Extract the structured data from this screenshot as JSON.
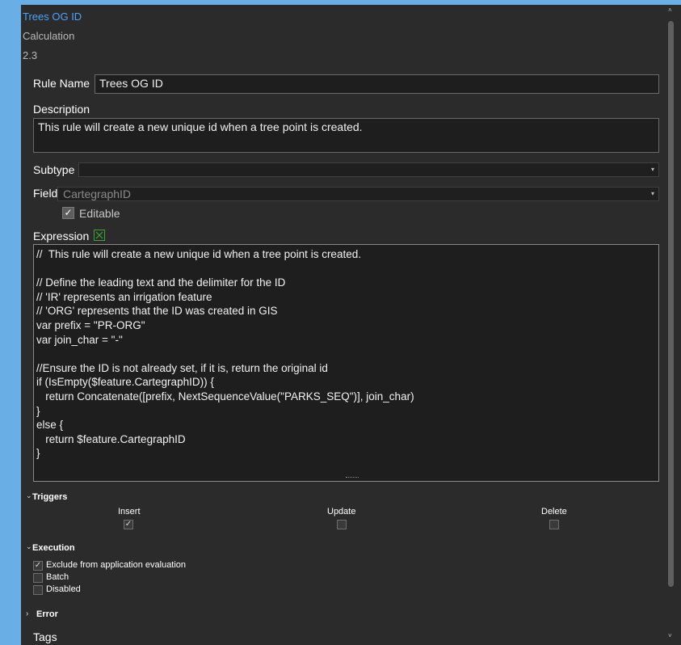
{
  "header": {
    "title": "Trees OG ID",
    "subtitle": "Calculation",
    "version": "2.3"
  },
  "form": {
    "rule_name_label": "Rule Name",
    "rule_name_value": "Trees OG ID",
    "description_label": "Description",
    "description_value": "This rule will create a new unique id when a tree point is created.",
    "subtype_label": "Subtype",
    "subtype_value": "",
    "field_label": "Field",
    "field_value": "CartegraphID",
    "editable_label": "Editable",
    "editable_checked": true,
    "expression_label": "Expression"
  },
  "expression_lines": [
    "//  This rule will create a new unique id when a tree point is created.",
    "",
    "// Define the leading text and the delimiter for the ID",
    "// 'IR' represents an irrigation feature",
    "// 'ORG' represents that the ID was created in GIS",
    "var prefix = \"PR-ORG\"",
    "var join_char = \"-\"",
    "",
    "//Ensure the ID is not already set, if it is, return the original id",
    "if (IsEmpty($feature.CartegraphID)) {",
    "   return Concatenate([prefix, NextSequenceValue(\"PARKS_SEQ\")], join_char)",
    "}",
    "else {",
    "   return $feature.CartegraphID",
    "}"
  ],
  "triggers": {
    "label": "Triggers",
    "items": [
      {
        "label": "Insert",
        "checked": true
      },
      {
        "label": "Update",
        "checked": false
      },
      {
        "label": "Delete",
        "checked": false
      }
    ]
  },
  "execution": {
    "label": "Execution",
    "items": [
      {
        "label": "Exclude from application evaluation",
        "checked": true
      },
      {
        "label": "Batch",
        "checked": false
      },
      {
        "label": "Disabled",
        "checked": false
      }
    ]
  },
  "error": {
    "label": "Error"
  },
  "tags": {
    "label": "Tags"
  },
  "colors": {
    "background": "#2b2b2b",
    "accent": "#4aa3ff",
    "desktop": "#6aaee6"
  }
}
